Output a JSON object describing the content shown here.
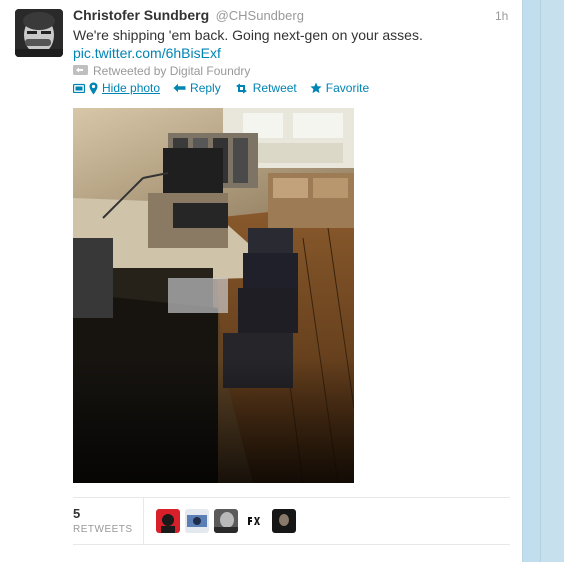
{
  "tweet": {
    "fullname": "Christofer Sundberg",
    "username": "@CHSundberg",
    "timestamp": "1h",
    "text": "We're shipping 'em back. Going next-gen on your asses.",
    "link": "pic.twitter.com/6hBisExf",
    "context": "Retweeted by Digital Foundry"
  },
  "actions": {
    "hide_photo": "Hide photo",
    "reply": "Reply",
    "retweet": "Retweet",
    "favorite": "Favorite"
  },
  "stats": {
    "retweets_count": "5",
    "retweets_label": "RETWEETS"
  },
  "icons": [
    "retweet-context-icon",
    "photo-icon",
    "location-pin-icon",
    "reply-arrow-icon",
    "retweet-icon",
    "favorite-star-icon"
  ],
  "colors": {
    "link": "#0084b4",
    "text": "#333333",
    "muted": "#999999",
    "page_bg": "#c0deed"
  }
}
